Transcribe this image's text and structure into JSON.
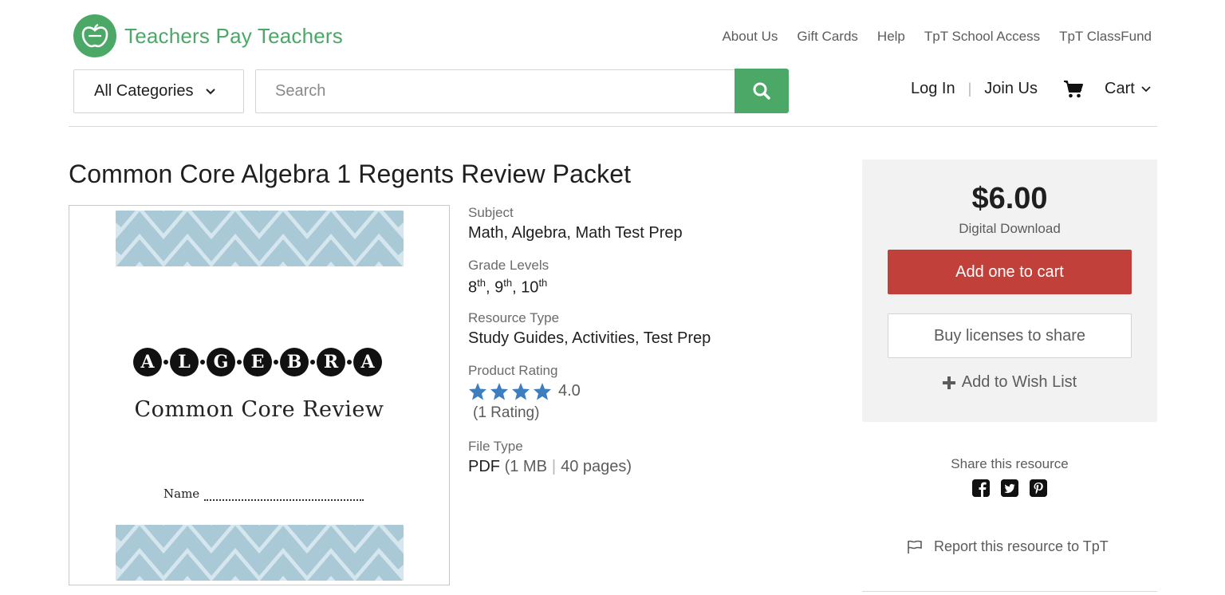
{
  "brand": {
    "name": "Teachers Pay Teachers",
    "color": "#4ca867"
  },
  "top_nav": [
    "About Us",
    "Gift Cards",
    "Help",
    "TpT School Access",
    "TpT ClassFund"
  ],
  "search": {
    "category": "All Categories",
    "placeholder": "Search"
  },
  "account": {
    "login": "Log In",
    "separator": "|",
    "join": "Join Us",
    "cart": "Cart"
  },
  "product": {
    "title": "Common Core Algebra 1 Regents Review Packet",
    "preview": {
      "letters": [
        "A",
        "L",
        "G",
        "E",
        "B",
        "R",
        "A"
      ],
      "subtitle": "Common Core Review",
      "name_label": "Name"
    },
    "details": {
      "subject_label": "Subject",
      "subject": "Math, Algebra, Math Test Prep",
      "grades_label": "Grade Levels",
      "grades": [
        {
          "num": "8",
          "suffix": "th"
        },
        {
          "num": "9",
          "suffix": "th"
        },
        {
          "num": "10",
          "suffix": "th"
        }
      ],
      "resource_label": "Resource Type",
      "resource": "Study Guides, Activities, Test Prep",
      "rating_label": "Product Rating",
      "rating": "4.0",
      "rating_stars": 4,
      "rating_count": "(1 Rating)",
      "filetype_label": "File Type",
      "filetype": "PDF",
      "filesize": "(1 MB",
      "pages": "40 pages)"
    }
  },
  "purchase": {
    "price": "$6.00",
    "price_sub": "Digital Download",
    "add_to_cart": "Add one to cart",
    "buy_licenses": "Buy licenses to share",
    "wish_list": "Add to Wish List",
    "accent": "#c1413a"
  },
  "share": {
    "label": "Share this resource",
    "networks": [
      "facebook",
      "twitter",
      "pinterest"
    ]
  },
  "report": "Report this resource to TpT"
}
